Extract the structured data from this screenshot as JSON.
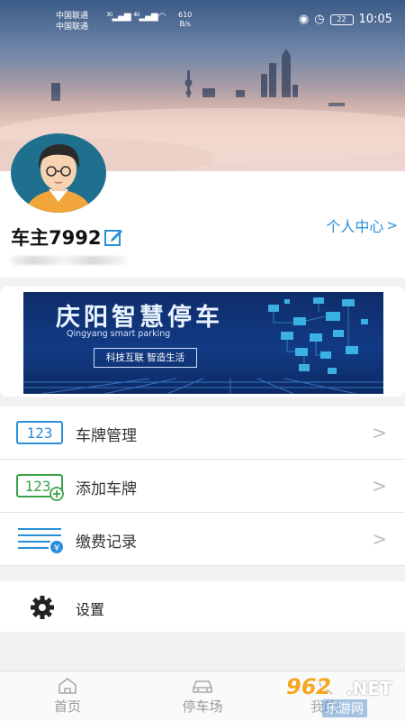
{
  "status_bar": {
    "carrier1": "中国联通",
    "carrier2": "中国联通",
    "net1": "3G",
    "net2": "4G",
    "speed_value": "610",
    "speed_unit": "B/s",
    "battery": "22",
    "time": "10:05"
  },
  "profile": {
    "username": "车主7992",
    "personal_center": "个人中心"
  },
  "banner": {
    "title": "庆阳智慧停车",
    "subtitle": "Qingyang smart parking",
    "slogan": "科技互联 智造生活"
  },
  "menu": {
    "items": [
      {
        "label": "车牌管理",
        "icon": "plate-123-icon"
      },
      {
        "label": "添加车牌",
        "icon": "add-plate-icon"
      },
      {
        "label": "缴费记录",
        "icon": "payment-record-icon"
      }
    ],
    "settings_label": "设置"
  },
  "tabs": {
    "home": "首页",
    "parking": "停车场",
    "mine": "我的"
  },
  "watermark": {
    "num": "962",
    "net": ".NET",
    "sub": "乐游网"
  },
  "colors": {
    "accent": "#2a8fd9",
    "menu_icon_blue": "#2a8fd9",
    "menu_icon_green": "#3aa34a",
    "banner_bg": "#123a84"
  }
}
